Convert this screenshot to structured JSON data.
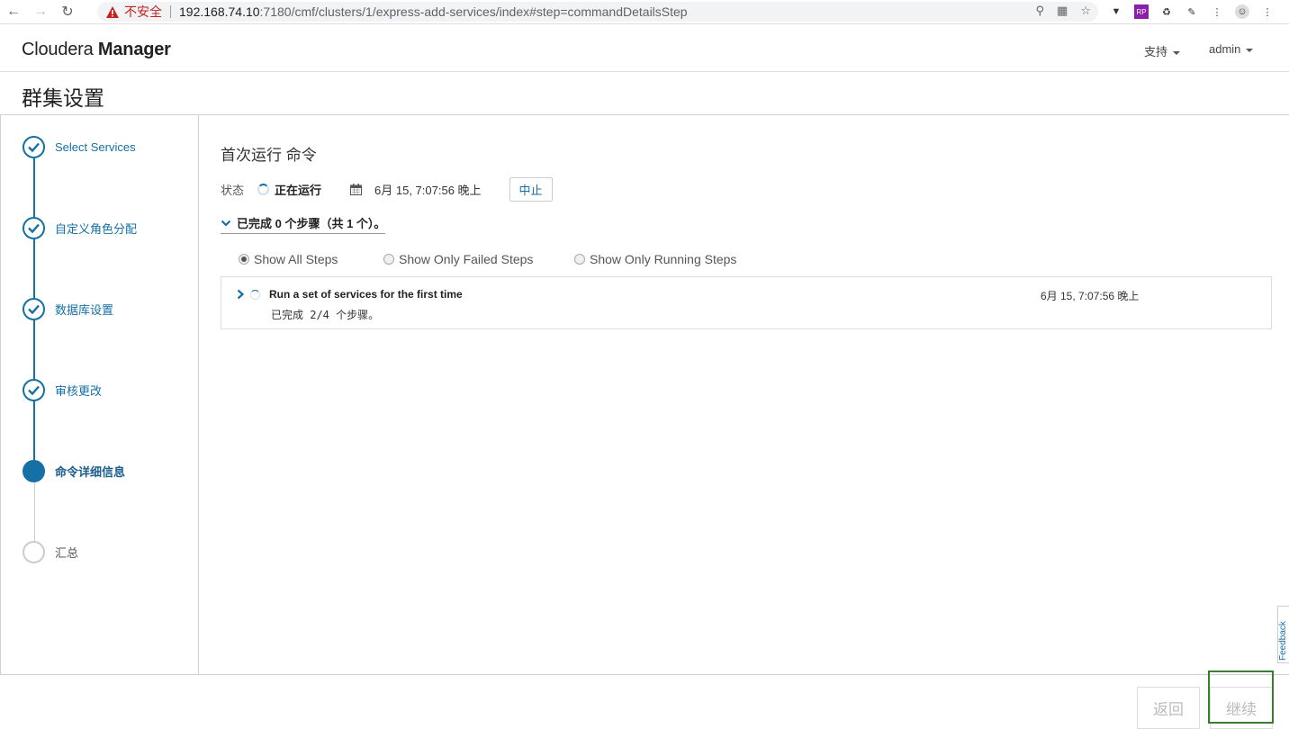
{
  "browser": {
    "insecure_label": "不安全",
    "url_host": "192.168.74.10",
    "url_path": ":7180/cmf/clusters/1/express-add-services/index#step=commandDetailsStep"
  },
  "header": {
    "brand_light": "Cloudera ",
    "brand_bold": "Manager",
    "support_label": "支持",
    "user_label": "admin"
  },
  "page": {
    "title": "群集设置"
  },
  "wizard": {
    "steps": [
      {
        "label": "Select Services",
        "state": "done"
      },
      {
        "label": "自定义角色分配",
        "state": "done"
      },
      {
        "label": "数据库设置",
        "state": "done"
      },
      {
        "label": "审核更改",
        "state": "done"
      },
      {
        "label": "命令详细信息",
        "state": "active"
      },
      {
        "label": "汇总",
        "state": "pending"
      }
    ]
  },
  "command": {
    "title": "首次运行 命令",
    "status_label": "状态",
    "status_value": "正在运行",
    "start_time": "6月 15, 7:07:56 晚上",
    "stop_label": "中止",
    "summary": "已完成 0 个步骤（共 1 个）。",
    "filters": [
      {
        "label": "Show All Steps",
        "checked": true
      },
      {
        "label": "Show Only Failed Steps",
        "checked": false
      },
      {
        "label": "Show Only Running Steps",
        "checked": false
      }
    ],
    "steps": [
      {
        "name": "Run a set of services for the first time",
        "time": "6月 15, 7:07:56 晚上",
        "progress": "已完成 2/4 个步骤。"
      }
    ]
  },
  "feedback_label": "Feedback",
  "footer": {
    "back_label": "返回",
    "continue_label": "继续"
  },
  "colors": {
    "accent": "#1570a6",
    "highlight": "#3b7d2e"
  }
}
